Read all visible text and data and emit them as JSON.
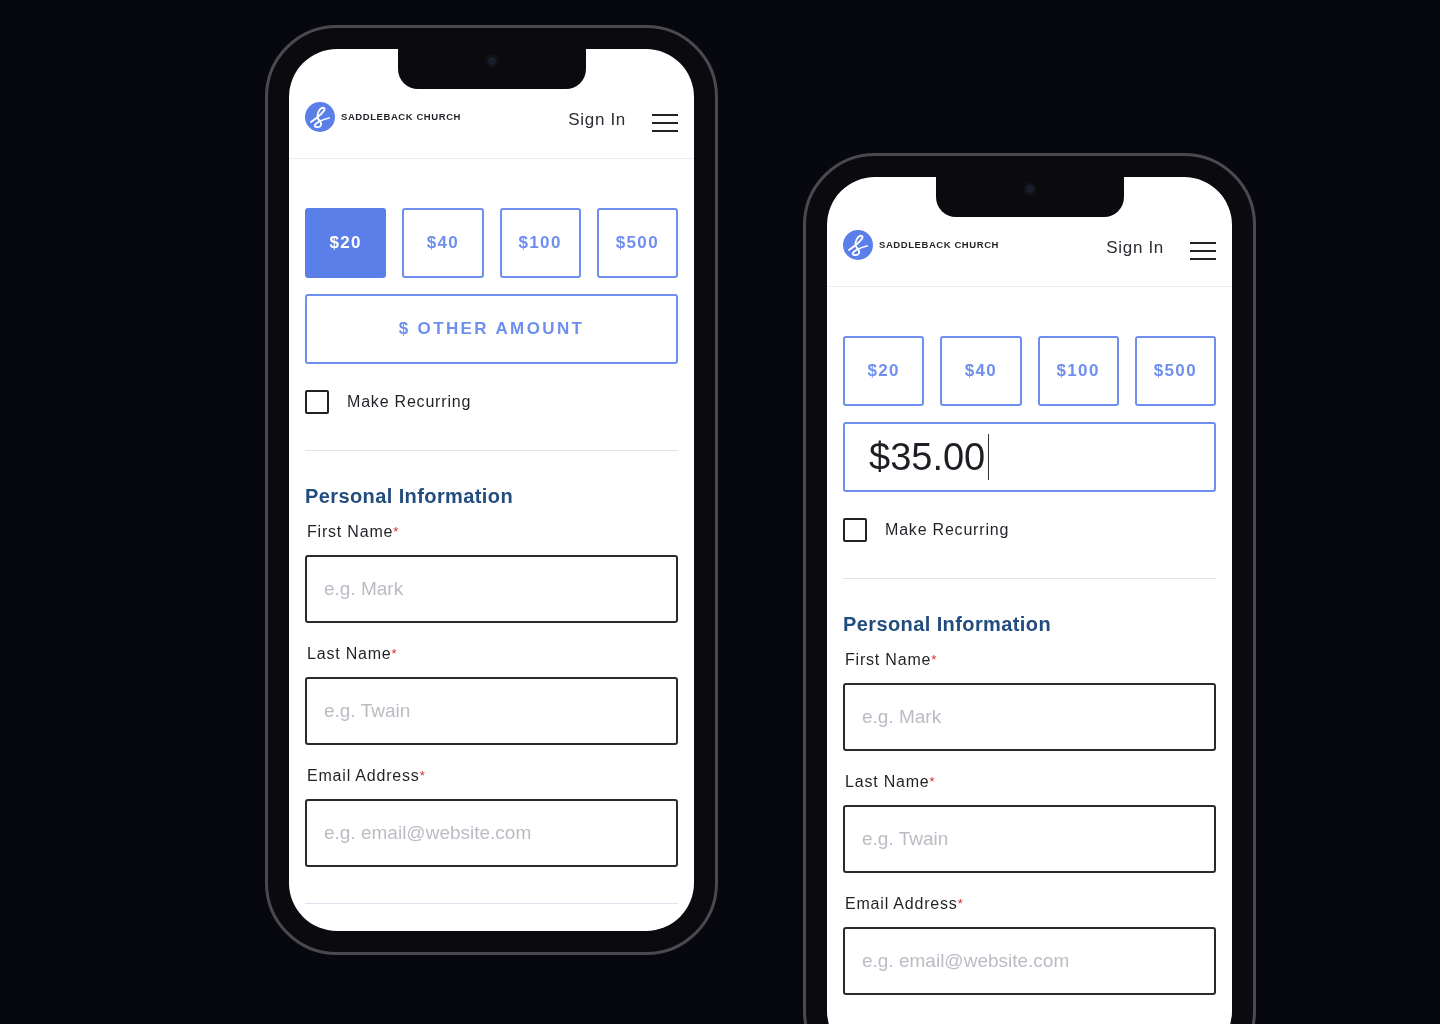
{
  "phones": [
    {
      "header": {
        "logo_text": "SADDLEBACK CHURCH",
        "sign_in": "Sign In"
      },
      "amounts": [
        {
          "label": "$20",
          "selected": true
        },
        {
          "label": "$40",
          "selected": false
        },
        {
          "label": "$100",
          "selected": false
        },
        {
          "label": "$500",
          "selected": false
        }
      ],
      "other_amount": {
        "kind": "button",
        "label": "$ OTHER AMOUNT"
      },
      "recurring": {
        "label": "Make Recurring",
        "checked": false
      },
      "section_title": "Personal Information",
      "fields": [
        {
          "label": "First Name",
          "mark": "*",
          "placeholder": "e.g. Mark"
        },
        {
          "label": "Last Name",
          "mark": "*",
          "placeholder": "e.g. Twain"
        },
        {
          "label": "Email Address",
          "mark": "*",
          "placeholder": "e.g. email@website.com"
        }
      ]
    },
    {
      "header": {
        "logo_text": "SADDLEBACK CHURCH",
        "sign_in": "Sign In"
      },
      "amounts": [
        {
          "label": "$20",
          "selected": false
        },
        {
          "label": "$40",
          "selected": false
        },
        {
          "label": "$100",
          "selected": false
        },
        {
          "label": "$500",
          "selected": false
        }
      ],
      "other_amount": {
        "kind": "input",
        "value": "$35.00"
      },
      "recurring": {
        "label": "Make Recurring",
        "checked": false
      },
      "section_title": "Personal Information",
      "fields": [
        {
          "label": "First Name",
          "mark": "*",
          "placeholder": "e.g. Mark"
        },
        {
          "label": "Last Name",
          "mark": "*",
          "placeholder": "e.g. Twain"
        },
        {
          "label": "Email Address",
          "mark": "*",
          "placeholder": "e.g. email@website.com"
        }
      ]
    }
  ]
}
